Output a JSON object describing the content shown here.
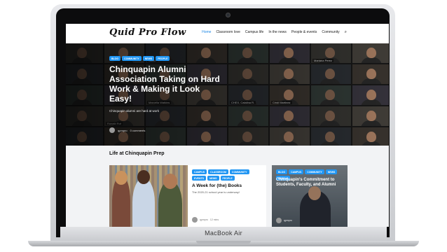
{
  "device": {
    "label": "MacBook Air"
  },
  "site": {
    "logo": "Quid Pro Flow",
    "nav": [
      "Home",
      "Classroom love",
      "Campus life",
      "In the news",
      "People & events",
      "Community"
    ],
    "search_icon": "search-icon"
  },
  "hero": {
    "tags": [
      "BLOG",
      "COMMUNITY",
      "NEWS",
      "PEOPLE"
    ],
    "title": "Chinquapin Alumni Association Taking on Hard Work & Making it Look Easy!",
    "excerpt": "Chinquapin alumni are hard at work",
    "author": "qpmpro",
    "comments": "0 comments",
    "tile_names": [
      "",
      "",
      "Sarah",
      "",
      "",
      "",
      "Mariana Perez",
      "",
      "",
      "",
      "",
      "",
      "",
      "",
      "",
      "",
      "",
      "",
      "Marcella Watkins",
      "",
      "CHEX, Catalina R.",
      "Cristi Martinez",
      "",
      "",
      "",
      "Ronald Ruf",
      "",
      "",
      "",
      "",
      "",
      "",
      "",
      "",
      "",
      "",
      "",
      "",
      "",
      ""
    ]
  },
  "section": {
    "title": "Life at Chinquapin Prep",
    "cards": [
      {
        "tags": [
          "CAMPUS",
          "CLASSROOM",
          "COMMUNITY",
          "EVENTS",
          "NEWS",
          "PEOPLE"
        ],
        "title": "A Week for (the) Books",
        "excerpt": "The 2020-21 school year is underway!",
        "author": "qpmpro",
        "meta": "12 mins"
      },
      {
        "tags": [
          "BLOG",
          "CAMPUS",
          "COMMUNITY",
          "NEWS",
          "PEOPLE"
        ],
        "title": "Chinquapin's Commitment to Students, Faculty, and Alumni",
        "author": "qpmpro"
      }
    ]
  },
  "colors": {
    "accent": "#2196f3",
    "active_nav": "#1e88e5"
  }
}
